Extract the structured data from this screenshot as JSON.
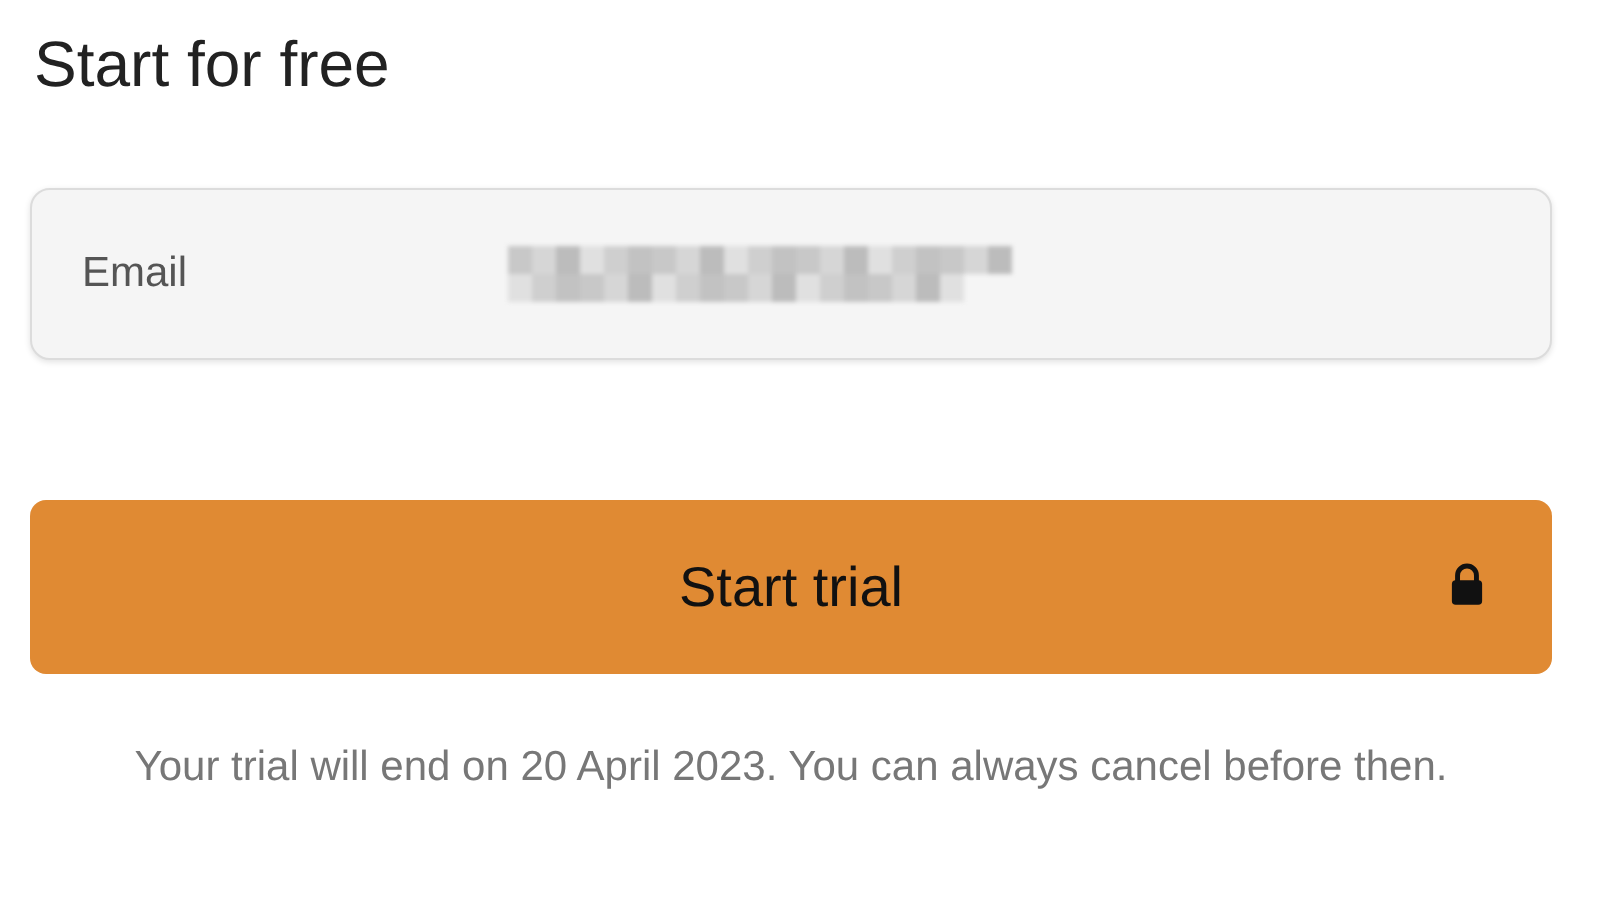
{
  "title": "Start for free",
  "email_field": {
    "label": "Email",
    "value_redacted": true
  },
  "submit_button": {
    "label": "Start trial",
    "locked": true
  },
  "note": "Your trial will end on 20 April 2023. You can always cancel before then."
}
